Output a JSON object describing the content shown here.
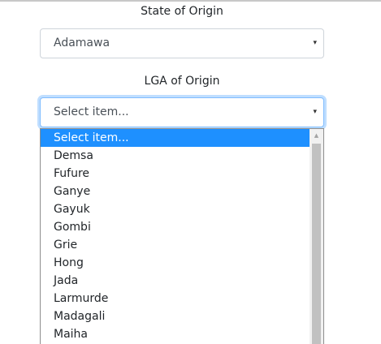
{
  "state_field": {
    "label": "State of Origin",
    "selected": "Adamawa"
  },
  "lga_field": {
    "label": "LGA of Origin",
    "selected": "Select item...",
    "options": [
      "Select item...",
      "Demsa",
      "Fufure",
      "Ganye",
      "Gayuk",
      "Gombi",
      "Grie",
      "Hong",
      "Jada",
      "Larmurde",
      "Madagali",
      "Maiha"
    ],
    "highlighted_index": 0
  },
  "icons": {
    "caret": "▾",
    "scroll_up": "▲"
  },
  "colors": {
    "highlight": "#1e90ff",
    "focus_border": "#80bdff"
  }
}
